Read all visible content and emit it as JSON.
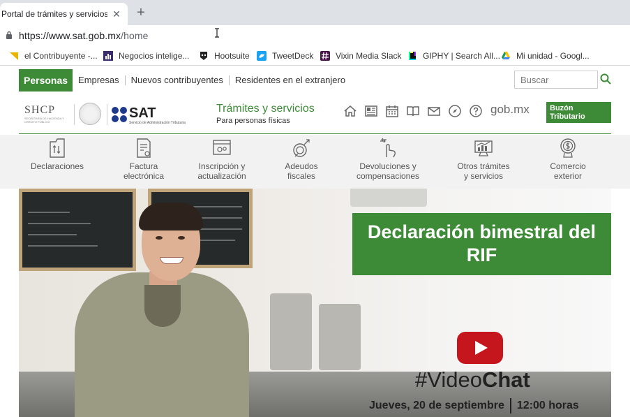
{
  "browser": {
    "tab_title": "Portal de trámites y servicios -",
    "tab_close": "✕",
    "new_tab": "+",
    "url_host": "https://www.sat.gob.mx",
    "url_path": "/home",
    "bookmarks": [
      {
        "label": "el Contribuyente -...",
        "icon": "wedge-icon",
        "color": "#e8b400"
      },
      {
        "label": "Negocios intelige...",
        "icon": "chart-icon",
        "color": "#3b2c6e"
      },
      {
        "label": "Hootsuite",
        "icon": "owl-icon",
        "color": "#222222"
      },
      {
        "label": "TweetDeck",
        "icon": "bird-icon",
        "color": "#1da1f2"
      },
      {
        "label": "Vixin Media Slack",
        "icon": "hash-icon",
        "color": "#4a154b"
      },
      {
        "label": "GIPHY | Search All...",
        "icon": "giphy-icon",
        "color": "#111111"
      },
      {
        "label": "Mi unidad - Googl...",
        "icon": "drive-icon",
        "color": "#0f9d58"
      }
    ]
  },
  "site": {
    "colors": {
      "brand_green": "#3d8b37"
    },
    "nav": {
      "active": "Personas",
      "links": [
        "Empresas",
        "Nuevos contribuyentes",
        "Residentes en el extranjero"
      ]
    },
    "search": {
      "placeholder": "Buscar"
    },
    "header": {
      "shcp": "SHCP",
      "shcp_sub": "SECRETARÍA DE HACIENDA Y CRÉDITO PÚBLICO",
      "sat": "SAT",
      "sat_sub": "Servicio de Administración Tributaria",
      "title": "Trámites y servicios",
      "subtitle": "Para personas físicas",
      "icons": [
        "home-icon",
        "news-icon",
        "calendar-icon",
        "book-icon",
        "mail-icon",
        "compass-icon",
        "help-icon"
      ],
      "gobmx": "gob.mx",
      "buzon": "Buzón Tributario"
    },
    "categories": [
      {
        "line1": "Declaraciones",
        "line2": "",
        "icon": "declaraciones-icon"
      },
      {
        "line1": "Factura",
        "line2": "electrónica",
        "icon": "factura-icon"
      },
      {
        "line1": "Inscripción y",
        "line2": "actualización",
        "icon": "inscripcion-icon"
      },
      {
        "line1": "Adeudos",
        "line2": "fiscales",
        "icon": "adeudos-icon"
      },
      {
        "line1": "Devoluciones y",
        "line2": "compensaciones",
        "icon": "devoluciones-icon"
      },
      {
        "line1": "Otros trámites",
        "line2": "y servicios",
        "icon": "otros-icon"
      },
      {
        "line1": "Comercio",
        "line2": "exterior",
        "icon": "comercio-icon"
      }
    ],
    "banner": {
      "headline_1": "Declaración bimestral del",
      "headline_2": "RIF",
      "hashtag_prefix": "#Video",
      "hashtag_bold": "Chat",
      "date": "Jueves, 20 de septiembre",
      "time": "12:00 horas"
    }
  }
}
